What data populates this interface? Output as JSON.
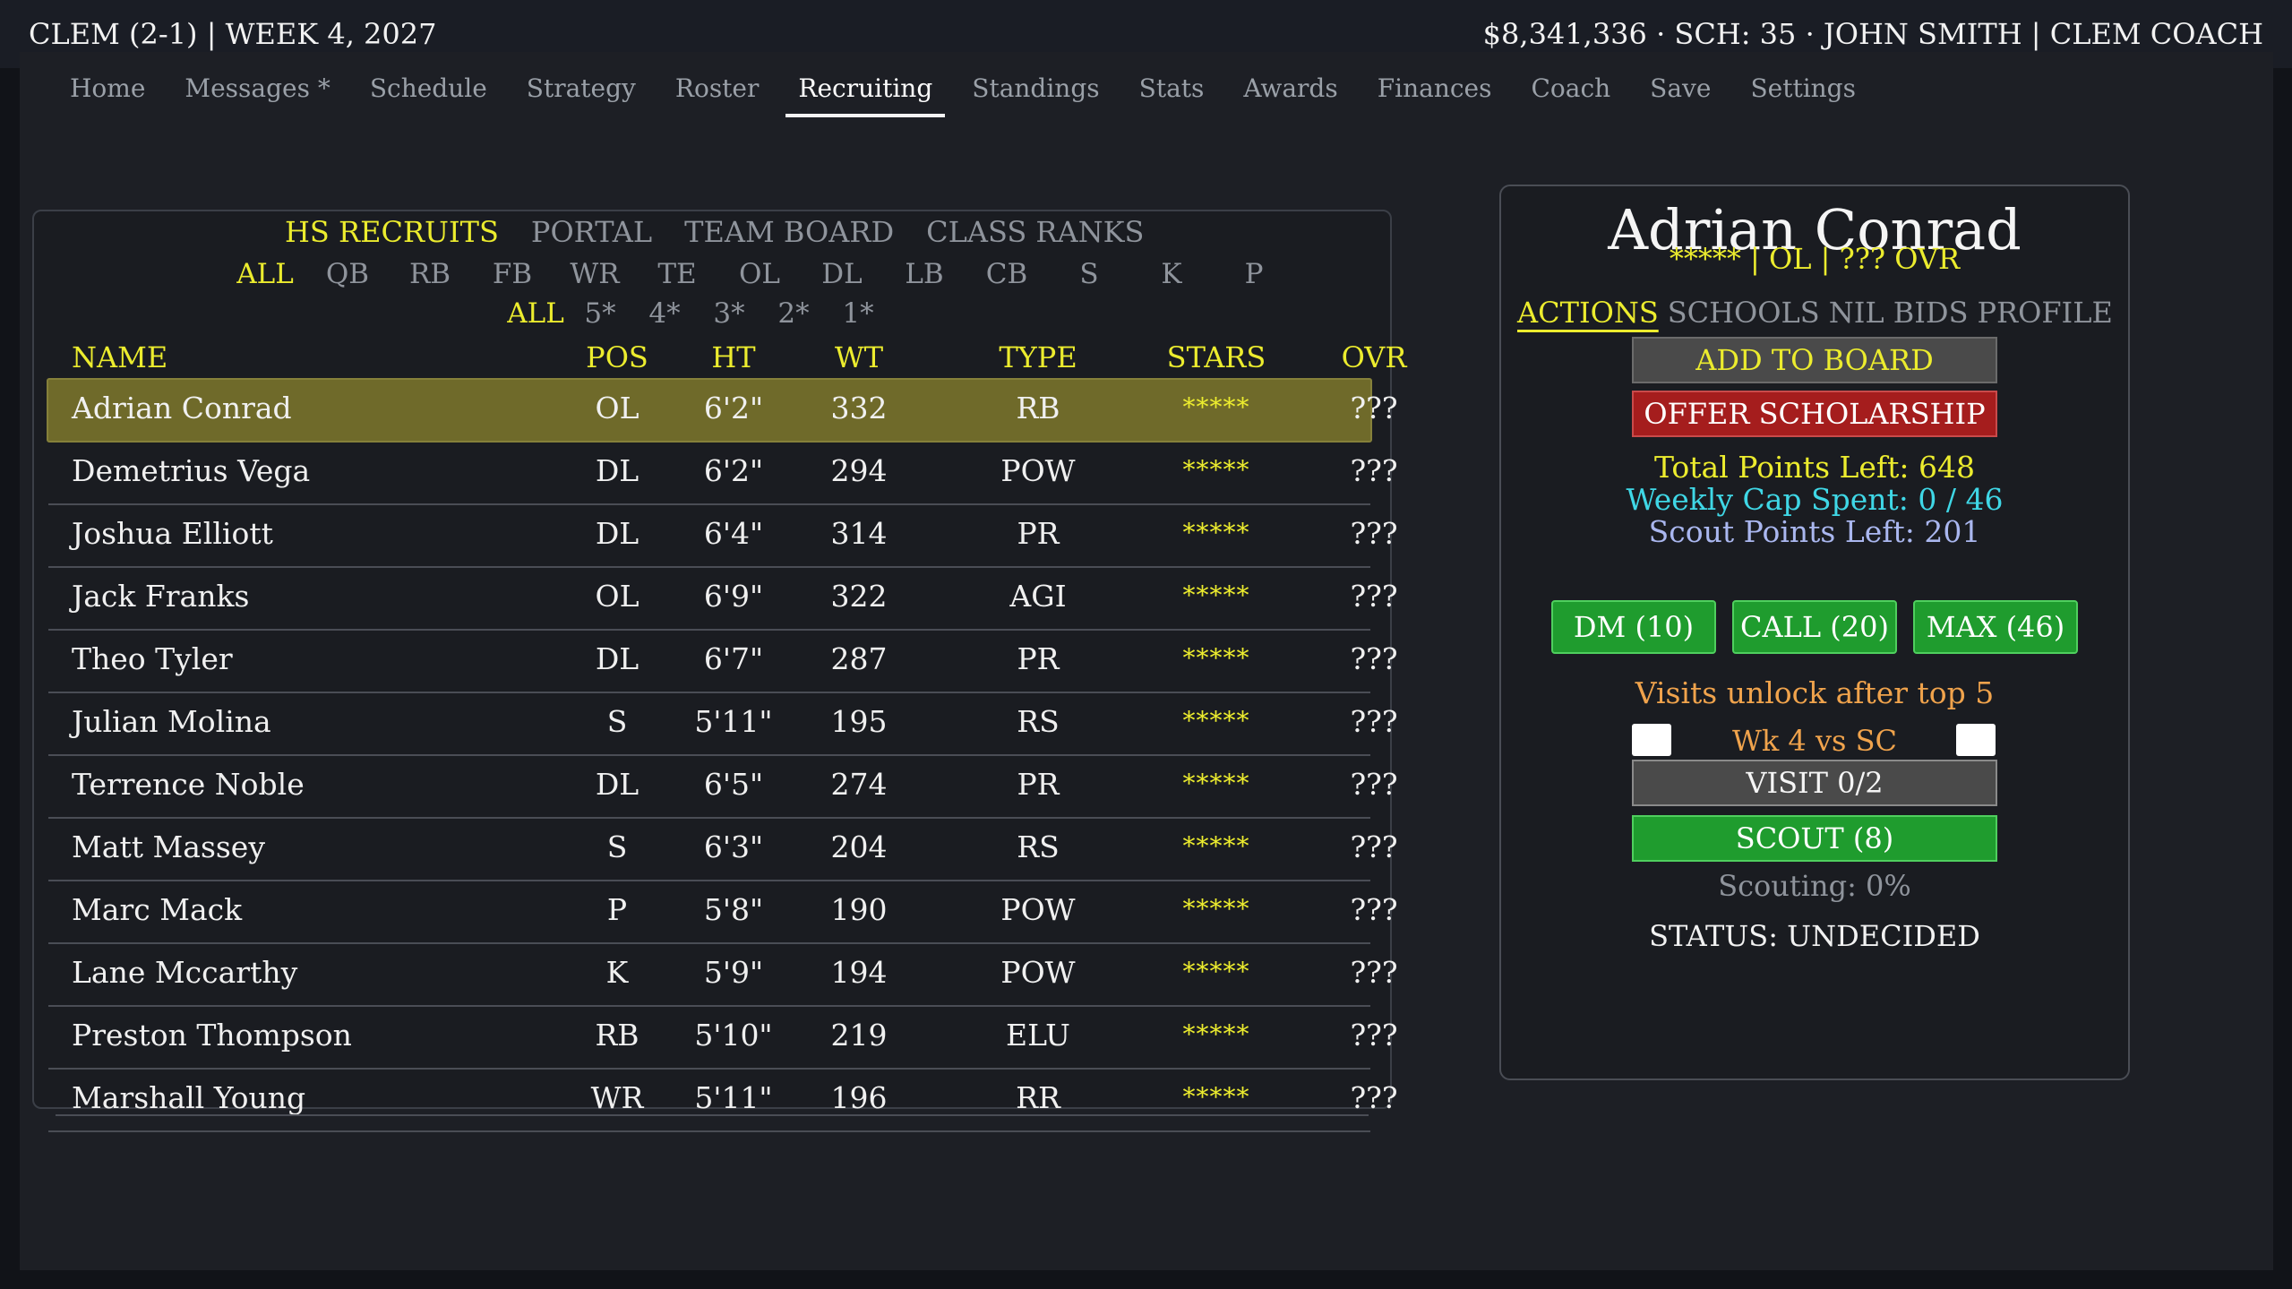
{
  "topbar": {
    "left": "CLEM (2-1) | WEEK 4, 2027",
    "right": "$8,341,336 · SCH: 35 · JOHN SMITH | CLEM COACH"
  },
  "nav": [
    "Home",
    "Messages *",
    "Schedule",
    "Strategy",
    "Roster",
    "Recruiting",
    "Standings",
    "Stats",
    "Awards",
    "Finances",
    "Coach",
    "Save",
    "Settings"
  ],
  "nav_active": "Recruiting",
  "subtabs": [
    "HS RECRUITS",
    "PORTAL",
    "TEAM BOARD",
    "CLASS RANKS"
  ],
  "subtab_active": "HS RECRUITS",
  "positions": [
    "ALL",
    "QB",
    "RB",
    "FB",
    "WR",
    "TE",
    "OL",
    "DL",
    "LB",
    "CB",
    "S",
    "K",
    "P"
  ],
  "position_active": "ALL",
  "stars_filter": [
    "ALL",
    "5*",
    "4*",
    "3*",
    "2*",
    "1*"
  ],
  "stars_active": "ALL",
  "table": {
    "headers": {
      "name": "NAME",
      "pos": "POS",
      "ht": "HT",
      "wt": "WT",
      "type": "TYPE",
      "stars": "STARS",
      "ovr": "OVR"
    },
    "rows": [
      {
        "name": "Adrian Conrad",
        "pos": "OL",
        "ht": "6'2\"",
        "wt": "332",
        "type": "RB",
        "stars": "*****",
        "ovr": "???",
        "selected": true
      },
      {
        "name": "Demetrius Vega",
        "pos": "DL",
        "ht": "6'2\"",
        "wt": "294",
        "type": "POW",
        "stars": "*****",
        "ovr": "???"
      },
      {
        "name": "Joshua Elliott",
        "pos": "DL",
        "ht": "6'4\"",
        "wt": "314",
        "type": "PR",
        "stars": "*****",
        "ovr": "???"
      },
      {
        "name": "Jack Franks",
        "pos": "OL",
        "ht": "6'9\"",
        "wt": "322",
        "type": "AGI",
        "stars": "*****",
        "ovr": "???"
      },
      {
        "name": "Theo Tyler",
        "pos": "DL",
        "ht": "6'7\"",
        "wt": "287",
        "type": "PR",
        "stars": "*****",
        "ovr": "???"
      },
      {
        "name": "Julian Molina",
        "pos": "S",
        "ht": "5'11\"",
        "wt": "195",
        "type": "RS",
        "stars": "*****",
        "ovr": "???"
      },
      {
        "name": "Terrence Noble",
        "pos": "DL",
        "ht": "6'5\"",
        "wt": "274",
        "type": "PR",
        "stars": "*****",
        "ovr": "???"
      },
      {
        "name": "Matt Massey",
        "pos": "S",
        "ht": "6'3\"",
        "wt": "204",
        "type": "RS",
        "stars": "*****",
        "ovr": "???"
      },
      {
        "name": "Marc Mack",
        "pos": "P",
        "ht": "5'8\"",
        "wt": "190",
        "type": "POW",
        "stars": "*****",
        "ovr": "???"
      },
      {
        "name": "Lane Mccarthy",
        "pos": "K",
        "ht": "5'9\"",
        "wt": "194",
        "type": "POW",
        "stars": "*****",
        "ovr": "???"
      },
      {
        "name": "Preston Thompson",
        "pos": "RB",
        "ht": "5'10\"",
        "wt": "219",
        "type": "ELU",
        "stars": "*****",
        "ovr": "???"
      },
      {
        "name": "Marshall Young",
        "pos": "WR",
        "ht": "5'11\"",
        "wt": "196",
        "type": "RR",
        "stars": "*****",
        "ovr": "???"
      }
    ]
  },
  "detail": {
    "name": "Adrian Conrad",
    "subtitle": "***** | OL | ??? OVR",
    "tabs": [
      "ACTIONS",
      "SCHOOLS",
      "NIL BIDS",
      "PROFILE"
    ],
    "tab_active": "ACTIONS",
    "add_to_board": "ADD TO BOARD",
    "offer": "OFFER SCHOLARSHIP",
    "total_points": "Total Points Left: 648",
    "weekly_cap": "Weekly Cap Spent: 0 / 46",
    "scout_points": "Scout Points Left: 201",
    "dm": "DM (10)",
    "call": "CALL (20)",
    "max": "MAX (46)",
    "visits_note": "Visits unlock after top 5",
    "week_label": "Wk 4 vs SC",
    "visit": "VISIT  0/2",
    "scout": "SCOUT (8)",
    "scouting": "Scouting: 0%",
    "status": "STATUS: UNDECIDED"
  },
  "colors": {
    "accent_yellow": "#ecec2e",
    "selected_row": "#6f6a2a",
    "offer_red": "#a51d1d",
    "action_green": "#1f9c2e",
    "cap_cyan": "#3fd7e6",
    "visit_orange": "#f0a34c"
  }
}
